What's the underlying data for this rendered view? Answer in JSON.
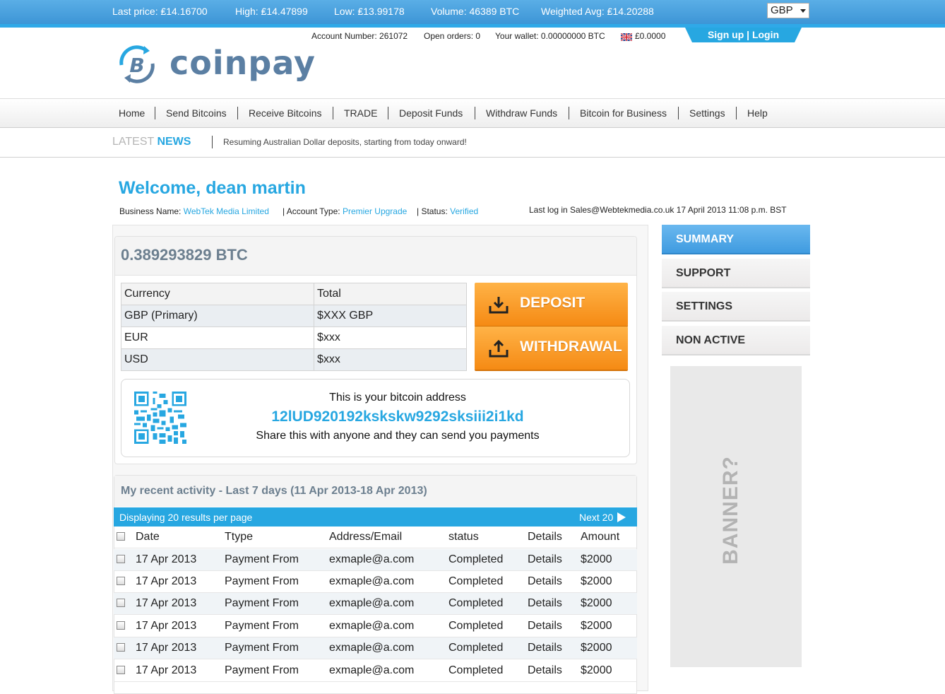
{
  "ticker": {
    "last_price": "Last price: ₤14.16700",
    "high": "High: ₤14.47899",
    "low": "Low: ₤13.99178",
    "volume": "Volume: 46389 BTC",
    "weighted_avg": "Weighted Avg: ₤14.20288",
    "currency": "GBP"
  },
  "account": {
    "number": "Account Number: 261072",
    "open_orders": "Open orders: 0",
    "wallet": "Your wallet: 0.00000000 BTC",
    "fiat": "£0.0000",
    "auth": "Sign up | Login"
  },
  "logo": {
    "text": "coinpay"
  },
  "nav": {
    "items": [
      "Home",
      "Send Bitcoins",
      "Receive Bitcoins",
      "TRADE",
      "Deposit Funds",
      "Withdraw Funds",
      "Bitcoin for Business",
      "Settings",
      "Help"
    ]
  },
  "news": {
    "title_a": "LATEST ",
    "title_b": "NEWS",
    "text": "Resuming Australian Dollar deposits, starting from today onward!"
  },
  "welcome": {
    "title": "Welcome, dean martin",
    "business_label": "Business Name: ",
    "business_value": "WebTek Media Limited",
    "type_label": "| Account Type: ",
    "type_value": "Premier Upgrade",
    "status_label": "| Status: ",
    "status_value": "Verified",
    "last_log": "Last log in Sales@Webtekmedia.co.uk 17 April 2013 11:08 p.m. BST"
  },
  "balance": {
    "amount": "0.389293829 BTC",
    "table": {
      "headers": [
        "Currency",
        "Total"
      ],
      "rows": [
        [
          "GBP (Primary)",
          "$XXX GBP"
        ],
        [
          "EUR",
          "$xxx"
        ],
        [
          "USD",
          "$xxx"
        ]
      ]
    },
    "deposit_label": "DEPOSIT",
    "withdrawal_label": "WITHDRAWAL"
  },
  "address": {
    "line1": "This is your bitcoin address",
    "address": "12lUD920192ksksk­w9292sksiii2i1kd",
    "line3": "Share this with anyone and they can send you payments"
  },
  "activity": {
    "title": "My recent activity - Last 7 days (11 Apr 2013-18 Apr 2013)",
    "displaying": "Displaying 20 results per page",
    "next": "Next 20",
    "headers": [
      "Date",
      "Ttype",
      "Address/Email",
      "status",
      "Details",
      "Amount"
    ],
    "rows": [
      [
        "17 Apr 2013",
        "Payment From",
        "exmaple@a.com",
        "Completed",
        "Details",
        "$2000"
      ],
      [
        "17 Apr 2013",
        "Payment From",
        "exmaple@a.com",
        "Completed",
        "Details",
        "$2000"
      ],
      [
        "17 Apr 2013",
        "Payment From",
        "exmaple@a.com",
        "Completed",
        "Details",
        "$2000"
      ],
      [
        "17 Apr 2013",
        "Payment From",
        "exmaple@a.com",
        "Completed",
        "Details",
        "$2000"
      ],
      [
        "17 Apr 2013",
        "Payment From",
        "exmaple@a.com",
        "Completed",
        "Details",
        "$2000"
      ],
      [
        "17 Apr 2013",
        "Payment From",
        "exmaple@a.com",
        "Completed",
        "Details",
        "$2000"
      ]
    ]
  },
  "sidebar": {
    "items": [
      "SUMMARY",
      "SUPPORT",
      "SETTINGS",
      "NON ACTIVE"
    ],
    "banner": "BANNER?"
  },
  "colors": {
    "accent": "#27a7e1",
    "orange": "#f58a14",
    "header_blue": "#3d95d6"
  }
}
